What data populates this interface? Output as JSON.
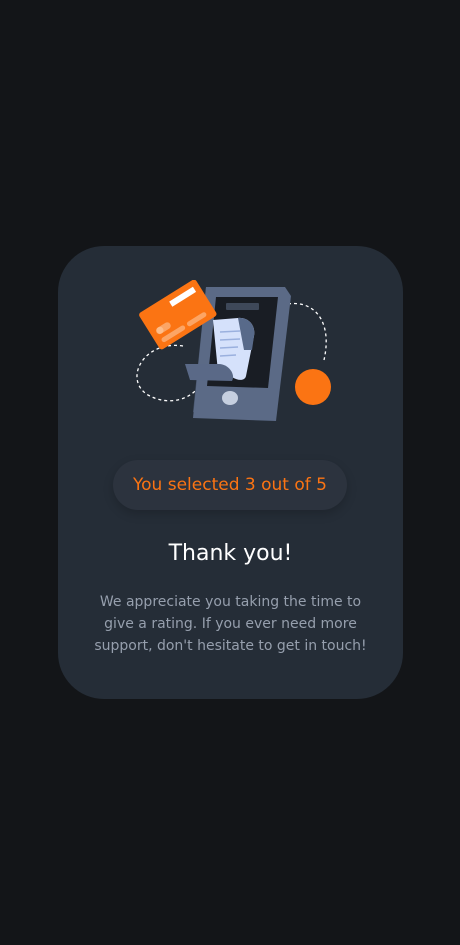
{
  "rating": {
    "selected": 3,
    "max": 5,
    "selected_text": "You selected 3 out of 5"
  },
  "thank_you": {
    "title": "Thank you!",
    "message": "We appreciate you taking the time to give a rating. If you ever need more support, don't hesitate to get in touch!"
  },
  "colors": {
    "background": "#131518",
    "card": "#252d37",
    "accent": "#fb7413",
    "text_primary": "#ffffff",
    "text_secondary": "#969fad"
  },
  "illustration": {
    "icon": "phone-payment-receipt-illustration"
  }
}
